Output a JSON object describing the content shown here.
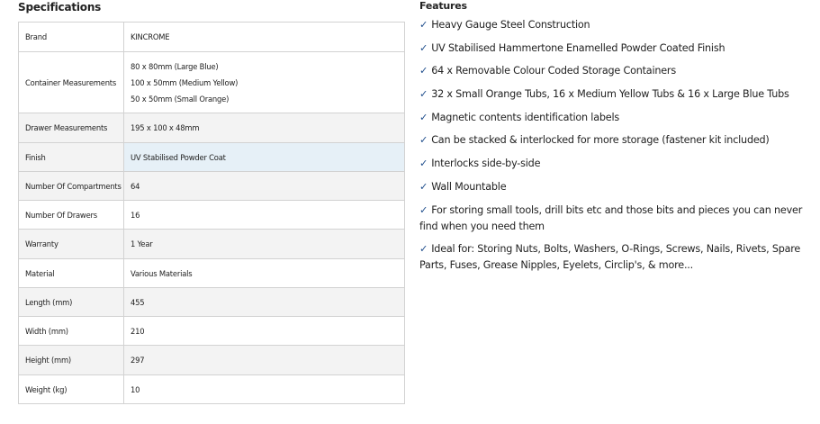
{
  "specifications": {
    "title": "Specifications",
    "rows": [
      {
        "label": "Brand",
        "value": "KINCROME"
      },
      {
        "label": "Container Measurements",
        "values": [
          "80 x 80mm (Large Blue)",
          "100 x 50mm (Medium Yellow)",
          "50 x 50mm (Small Orange)"
        ]
      },
      {
        "label": "Drawer Measurements",
        "value": "195 x 100 x 48mm"
      },
      {
        "label": "Finish",
        "value": "UV Stabilised Powder Coat"
      },
      {
        "label": "Number Of Compartments",
        "value": "64"
      },
      {
        "label": "Number Of Drawers",
        "value": "16"
      },
      {
        "label": "Warranty",
        "value": "1 Year"
      },
      {
        "label": "Material",
        "value": "Various Materials"
      },
      {
        "label": "Length (mm)",
        "value": "455"
      },
      {
        "label": "Width (mm)",
        "value": "210"
      },
      {
        "label": "Height (mm)",
        "value": "297"
      },
      {
        "label": "Weight (kg)",
        "value": "10"
      }
    ]
  },
  "features": {
    "title": "Features",
    "check_mark": "✓",
    "check_color": "#1f4e8c",
    "items": [
      "Heavy Gauge Steel Construction",
      "UV Stabilised Hammertone Enamelled Powder Coated Finish",
      "64 x Removable Colour Coded Storage Containers",
      "32 x Small Orange Tubs, 16 x Medium Yellow Tubs & 16 x Large Blue Tubs",
      "Magnetic contents identification labels",
      "Can be stacked & interlocked for more storage (fastener kit included)",
      "Interlocks side-by-side",
      "Wall Mountable",
      "For storing small tools, drill bits etc and those bits and pieces you can never find when you need them",
      "Ideal for: Storing Nuts, Bolts, Washers, O-Rings, Screws, Nails, Rivets, Spare Parts, Fuses, Grease Nipples, Eyelets, Circlip's, & more..."
    ]
  }
}
